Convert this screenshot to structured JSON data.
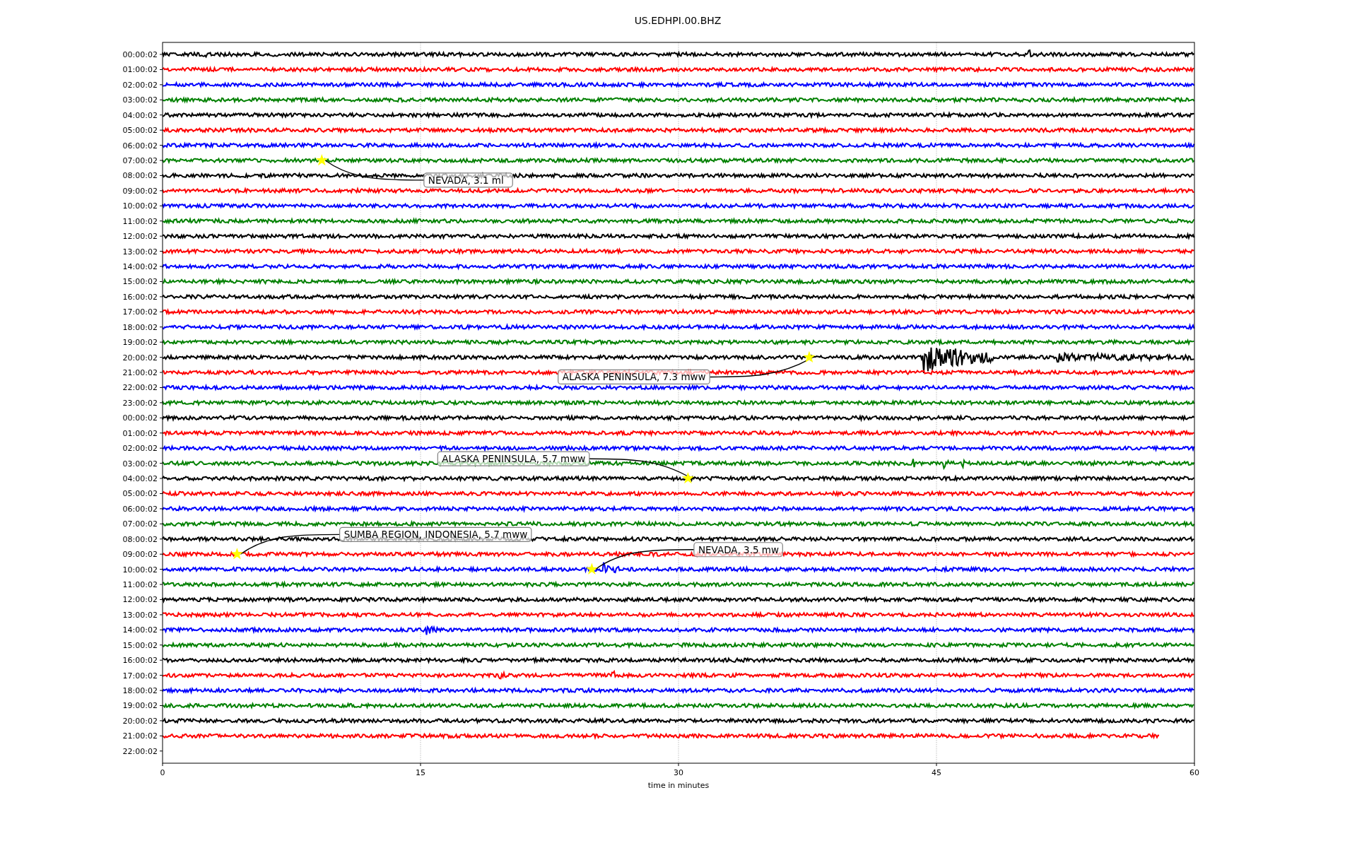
{
  "title": "US.EDHPI.00.BHZ",
  "row_labels": [
    "00:00:02",
    "01:00:02",
    "02:00:02",
    "03:00:02",
    "04:00:02",
    "05:00:02",
    "06:00:02",
    "07:00:02",
    "08:00:02",
    "09:00:02",
    "10:00:02",
    "11:00:02",
    "12:00:02",
    "13:00:02",
    "14:00:02",
    "15:00:02",
    "16:00:02",
    "17:00:02",
    "18:00:02",
    "19:00:02",
    "20:00:02",
    "21:00:02",
    "22:00:02",
    "23:00:02",
    "00:00:02",
    "01:00:02",
    "02:00:02",
    "03:00:02",
    "04:00:02",
    "05:00:02",
    "06:00:02",
    "07:00:02",
    "08:00:02",
    "09:00:02",
    "10:00:02",
    "11:00:02",
    "12:00:02",
    "13:00:02",
    "14:00:02",
    "15:00:02",
    "16:00:02",
    "17:00:02",
    "18:00:02",
    "19:00:02",
    "20:00:02",
    "21:00:02",
    "22:00:02"
  ],
  "x_axis": {
    "ticks": [
      "0",
      "15",
      "30",
      "45",
      "60"
    ],
    "label": "time in minutes"
  },
  "events": [
    {
      "label": "NEVADA, 3.1 ml"
    },
    {
      "label": "ALASKA PENINSULA, 7.3 mww"
    },
    {
      "label": "ALASKA PENINSULA, 5.7 mww"
    },
    {
      "label": "SUMBA REGION, INDONESIA, 5.7 mww"
    },
    {
      "label": "NEVADA, 3.5 mw"
    }
  ]
}
